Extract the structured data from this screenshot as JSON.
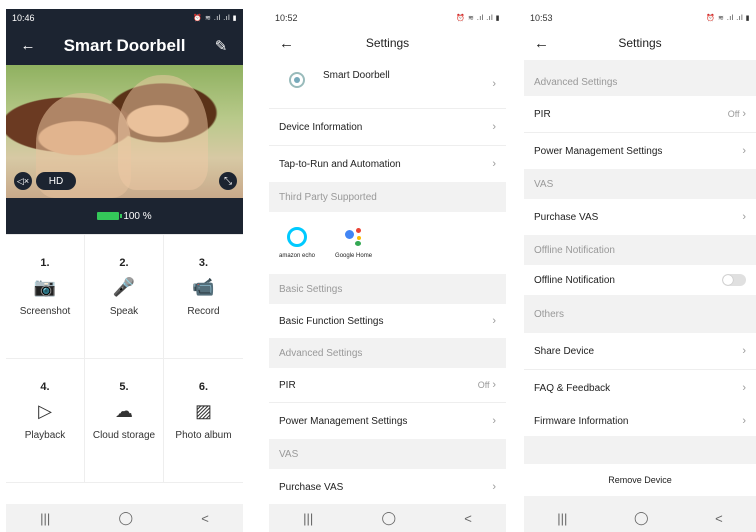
{
  "screen1": {
    "status_time": "10:46",
    "status_right": "⏰ ≋ .ıl .ıl ▮",
    "title": "Smart Doorbell",
    "back_icon": "←",
    "edit_icon": "✎",
    "hd_label": "HD",
    "battery": "100 %",
    "features": [
      {
        "num": "1.",
        "icon": "camera-icon",
        "glyph": "📷",
        "label": "Screenshot"
      },
      {
        "num": "2.",
        "icon": "microphone-icon",
        "glyph": "🎤",
        "label": "Speak"
      },
      {
        "num": "3.",
        "icon": "video-record-icon",
        "glyph": "📹",
        "label": "Record"
      },
      {
        "num": "4.",
        "icon": "play-icon",
        "glyph": "▷",
        "label": "Playback"
      },
      {
        "num": "5.",
        "icon": "cloud-icon",
        "glyph": "☁",
        "label": "Cloud storage"
      },
      {
        "num": "6.",
        "icon": "photo-icon",
        "glyph": "▨",
        "label": "Photo album"
      }
    ]
  },
  "screen2": {
    "status_time": "10:52",
    "status_right": "⏰ ≋ .ıl .ıl ▮",
    "title": "Settings",
    "device_name": "Smart Doorbell",
    "device_information": "Device Information",
    "tap_to_run": "Tap-to-Run and Automation",
    "third_party_header": "Third Party Supported",
    "amazon_label": "amazon echo",
    "google_label": "Google Home",
    "basic_header": "Basic Settings",
    "basic_function": "Basic Function Settings",
    "advanced_header": "Advanced Settings",
    "pir": "PIR",
    "pir_value": "Off",
    "power_management": "Power Management Settings",
    "vas_header": "VAS",
    "purchase_vas": "Purchase VAS"
  },
  "screen3": {
    "status_time": "10:53",
    "status_right": "⏰ ≋ .ıl .ıl ▮",
    "title": "Settings",
    "advanced_header": "Advanced Settings",
    "pir": "PIR",
    "pir_value": "Off",
    "power_management": "Power Management Settings",
    "vas_header": "VAS",
    "purchase_vas": "Purchase VAS",
    "offline_header": "Offline Notification",
    "offline_row": "Offline Notification",
    "offline_enabled": false,
    "others_header": "Others",
    "share_device": "Share Device",
    "faq": "FAQ & Feedback",
    "firmware": "Firmware Information",
    "remove_device": "Remove Device"
  },
  "nav": {
    "recent": "|||",
    "home": "◯",
    "back": "<"
  },
  "colors": {
    "header_dark": "#1c2431",
    "battery_green": "#34c759",
    "alexa_blue": "#00caff"
  }
}
